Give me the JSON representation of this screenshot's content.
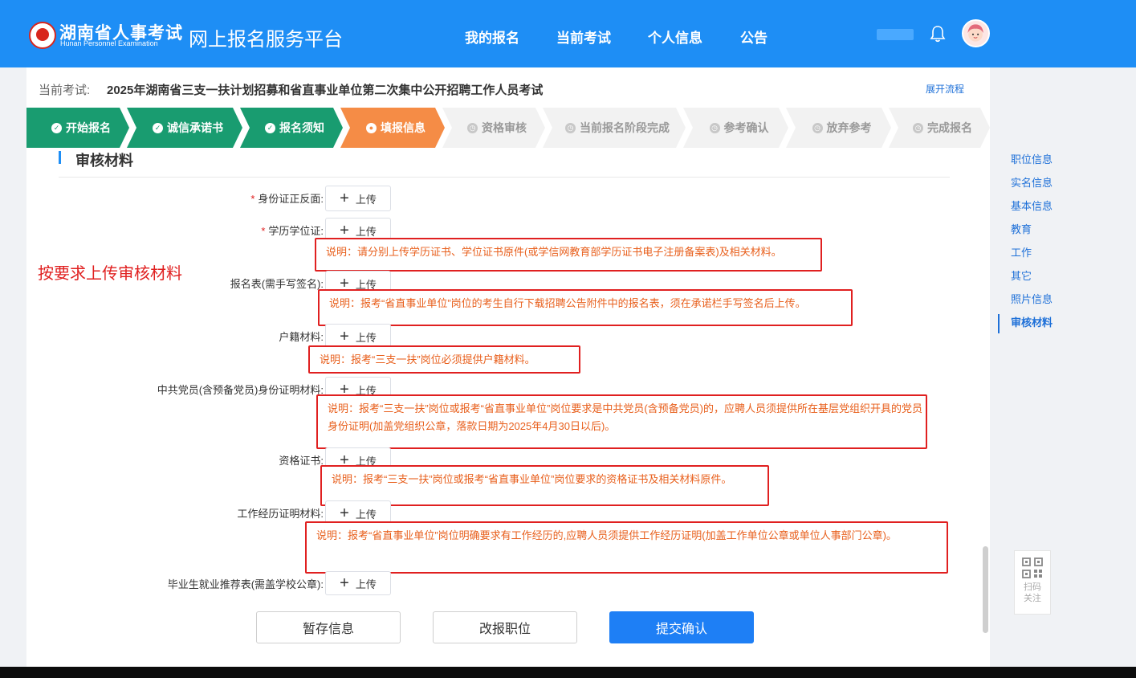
{
  "header": {
    "logo_cn": "湖南省人事考试",
    "logo_en": "Hunan Personnel Examination",
    "platform_title": "网上报名服务平台",
    "nav": [
      "我的报名",
      "当前考试",
      "个人信息",
      "公告"
    ]
  },
  "exam": {
    "label": "当前考试:",
    "name": "2025年湖南省三支一扶计划招募和省直事业单位第二次集中公开招聘工作人员考试",
    "expand_label": "展开流程"
  },
  "steps": [
    {
      "label": "开始报名",
      "status": "done"
    },
    {
      "label": "诚信承诺书",
      "status": "done"
    },
    {
      "label": "报名须知",
      "status": "done"
    },
    {
      "label": "填报信息",
      "status": "active"
    },
    {
      "label": "资格审核",
      "status": "pending"
    },
    {
      "label": "当前报名阶段完成",
      "status": "pending"
    },
    {
      "label": "参考确认",
      "status": "pending"
    },
    {
      "label": "放弃参考",
      "status": "pending"
    },
    {
      "label": "完成报名",
      "status": "pending"
    }
  ],
  "section_title": "审核材料",
  "upload_label": "上传",
  "fields": [
    {
      "label": "身份证正反面:",
      "required": true
    },
    {
      "label": "学历学位证:",
      "required": true
    },
    {
      "label": "报名表(需手写签名):",
      "required": false
    },
    {
      "label": "户籍材料:",
      "required": false
    },
    {
      "label": "中共党员(含预备党员)身份证明材料:",
      "required": false
    },
    {
      "label": "资格证书:",
      "required": false
    },
    {
      "label": "工作经历证明材料:",
      "required": false
    },
    {
      "label": "毕业生就业推荐表(需盖学校公章):",
      "required": false
    }
  ],
  "notes": [
    "说明：请分别上传学历证书、学位证书原件(或学信网教育部学历证书电子注册备案表)及相关材料。",
    "说明：报考“省直事业单位”岗位的考生自行下载招聘公告附件中的报名表，须在承诺栏手写签名后上传。",
    "说明：报考“三支一扶”岗位必须提供户籍材料。",
    "说明：报考“三支一扶”岗位或报考“省直事业单位”岗位要求是中共党员(含预备党员)的，应聘人员须提供所在基层党组织开具的党员身份证明(加盖党组织公章，落款日期为2025年4月30日以后)。",
    "说明：报考“三支一扶”岗位或报考“省直事业单位”岗位要求的资格证书及相关材料原件。",
    "说明：报考“省直事业单位”岗位明确要求有工作经历的,应聘人员须提供工作经历证明(加盖工作单位公章或单位人事部门公章)。"
  ],
  "annotation": "按要求上传审核材料",
  "actions": {
    "save": "暂存信息",
    "change": "改报职位",
    "submit": "提交确认"
  },
  "sidenav": [
    "职位信息",
    "实名信息",
    "基本信息",
    "教育",
    "工作",
    "其它",
    "照片信息",
    "审核材料"
  ],
  "qr": {
    "label": "扫码关注"
  },
  "colors": {
    "header": "#1e8ef5",
    "step_done": "#199c70",
    "step_active": "#f58c46",
    "primary": "#1e7ff5",
    "note_text": "#e85f1c",
    "note_border": "#e02020"
  }
}
